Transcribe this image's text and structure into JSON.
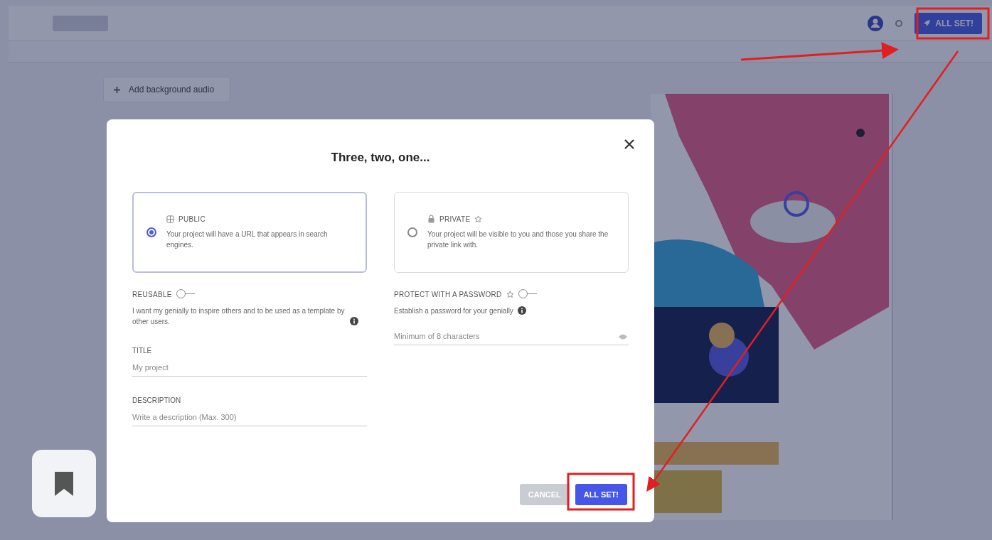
{
  "topbar": {
    "publish_button": "ALL SET!"
  },
  "toolbar": {
    "audio_button": "Add background audio"
  },
  "modal": {
    "title": "Three, two, one...",
    "visibility_options": [
      {
        "kind": "public",
        "label": "PUBLIC",
        "premium": false,
        "selected": true,
        "description": "Your project will have a URL that appears in search engines."
      },
      {
        "kind": "private",
        "label": "PRIVATE",
        "premium": true,
        "selected": false,
        "description": "Your project will be visible to you and those you share the private link with."
      }
    ],
    "reusable": {
      "label": "REUSABLE",
      "on": false,
      "description": "I want my genially to inspire others and to be used as a template by other users."
    },
    "password": {
      "label": "PROTECT WITH A PASSWORD",
      "premium": true,
      "on": false,
      "description": "Establish a password for your genially",
      "placeholder": "Minimum of 8 characters"
    },
    "title_field": {
      "label": "TITLE",
      "placeholder": "My project"
    },
    "description_field": {
      "label": "DESCRIPTION",
      "placeholder": "Write a description (Max. 300)"
    },
    "buttons": [
      {
        "kind": "secondary",
        "label": "CANCEL"
      },
      {
        "kind": "primary",
        "label": "ALL SET!"
      }
    ]
  }
}
